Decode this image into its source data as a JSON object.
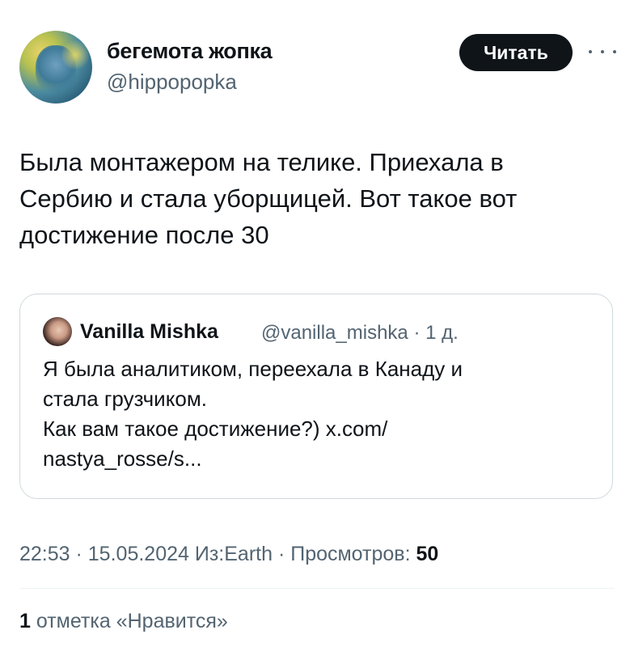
{
  "author": {
    "display_name": "бегемота жопка",
    "handle": "@hippopopka",
    "follow_label": "Читать",
    "more_icon": "more-horizontal-icon"
  },
  "tweet": {
    "text": "Была монтажером на телике. Приехала в\nСербию и стала уборщицей. Вот такое вот\nдостижение после 30"
  },
  "quote": {
    "display_name": "Vanilla Mishka",
    "meta": "@vanilla_mishka · 1 д.",
    "text": "Я была аналитиком, переехала в Канаду и\nстала грузчиком.\nКак вам такое достижение?) x.com/\nnastya_rosse/s..."
  },
  "meta": {
    "time": "22:53",
    "sep1": " · ",
    "date": "15.05.2024",
    "sep2": " ",
    "source": "Из:Earth",
    "sep3": " · ",
    "views_label": "Просмотров: ",
    "views_count": "50"
  },
  "likes": {
    "count": "1",
    "label": " отметка «Нравится»"
  }
}
